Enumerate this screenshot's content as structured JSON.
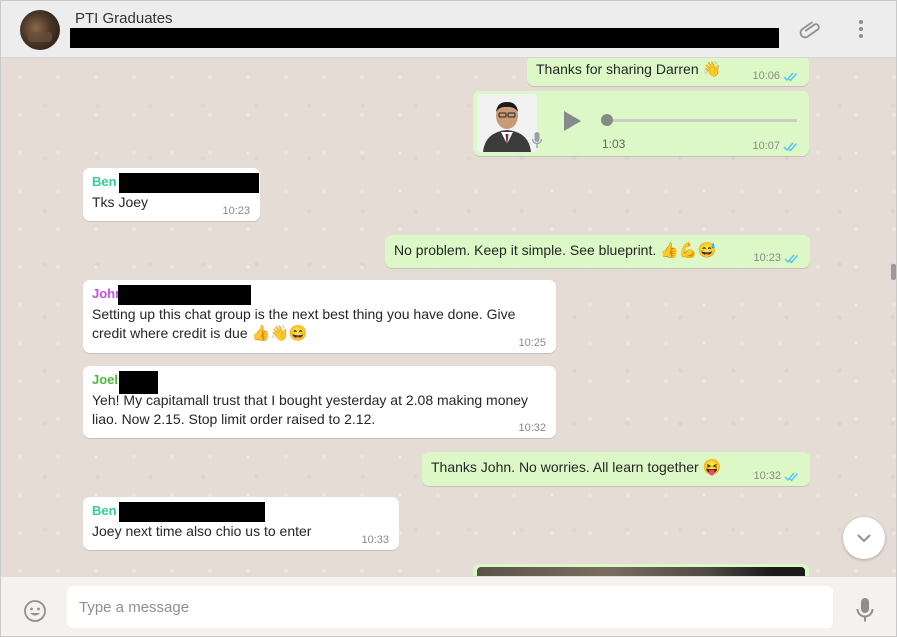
{
  "header": {
    "title": "PTI Graduates"
  },
  "icons": {
    "attach": "paperclip-icon",
    "menu": "kebab-menu-icon",
    "emoji": "smiley-icon",
    "mic": "microphone-icon",
    "scroll": "chevron-down-icon"
  },
  "messages": [
    {
      "text": "Thanks for sharing Darren",
      "emoji": "👋",
      "time": "10:06"
    },
    {
      "duration": "1:03",
      "time": "10:07"
    },
    {
      "sender": "Ben",
      "text": "Tks Joey",
      "time": "10:23"
    },
    {
      "text": "No problem. Keep it simple. See blueprint.",
      "emoji": "👍💪😅",
      "time": "10:23"
    },
    {
      "sender": "John",
      "text_line1": "Setting up this chat group is the next best thing you have done. Give",
      "text_line2": "credit where credit is due",
      "emoji": "👍👋😄",
      "time": "10:25"
    },
    {
      "sender": "Joel",
      "text_line1": "Yeh! My capitamall trust that I bought yesterday at 2.08 making money",
      "text_line2": "liao. Now 2.15. Stop limit order raised to 2.12.",
      "time": "10:32"
    },
    {
      "text": "Thanks John. No worries. All learn together",
      "emoji": "😝",
      "time": "10:32"
    },
    {
      "sender": "Ben",
      "text": "Joey next time also chio us to enter",
      "time": "10:33"
    }
  ],
  "composer": {
    "placeholder": "Type a message"
  },
  "colors": {
    "sender_ben": "#35cd96",
    "sender_john": "#c055d9",
    "sender_joel": "#4fb83d",
    "tick": "#4fc3f7",
    "outgoing_bg": "#dcf8c6"
  }
}
